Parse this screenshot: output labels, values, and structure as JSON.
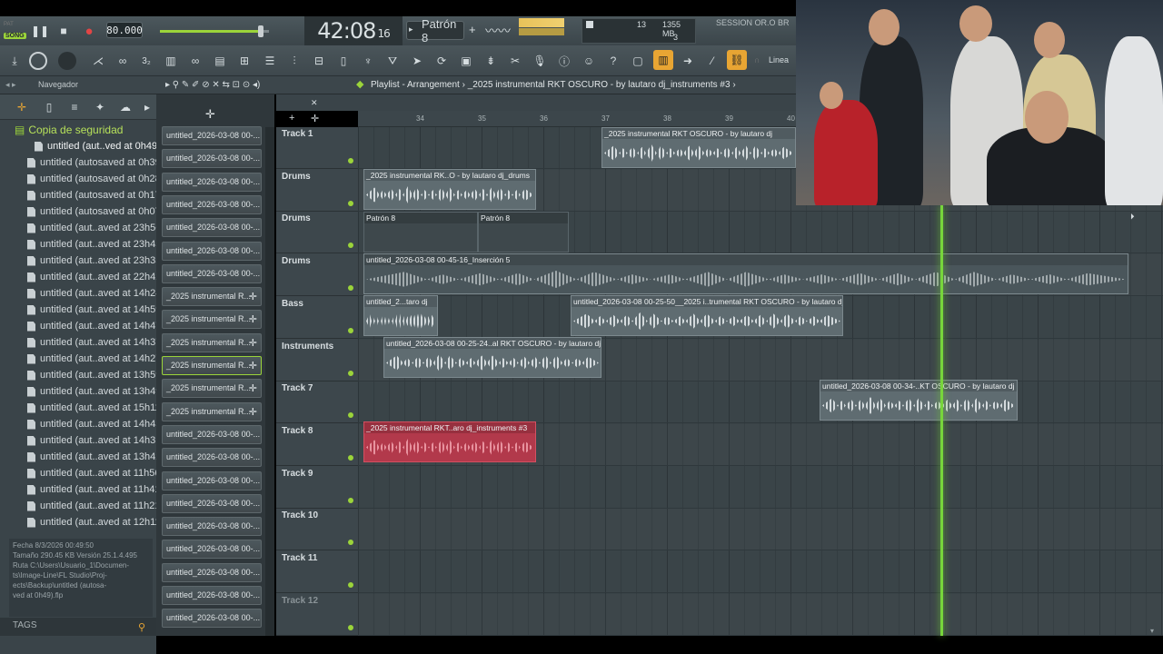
{
  "top": {
    "pat_label": "PAT",
    "song_label": "SONG",
    "bpm": "80.000",
    "time": "42:08",
    "time_sub": "16",
    "pattern": "Patrón 8",
    "cpu_value": "13",
    "ram": "1355 MB",
    "poly": "3",
    "session": "SESSION OR.O BR",
    "snap": "Linea"
  },
  "nav": {
    "navegador": "Navegador",
    "breadcrumb": "Playlist - Arrangement › _2025 instrumental RKT OSCURO - by lautaro dj_instruments #3 ›"
  },
  "browser": {
    "folder": "Copia de seguridad",
    "items": [
      "untitled (aut..ved at 0h49)",
      "untitled (autosaved at 0h39)",
      "untitled (autosaved at 0h28)",
      "untitled (autosaved at 0h17)",
      "untitled (autosaved at 0h07)",
      "untitled (aut..aved at 23h56)",
      "untitled (aut..aved at 23h45)",
      "untitled (aut..aved at 23h35)",
      "untitled (aut..aved at 22h42)",
      "untitled (aut..aved at 14h24)",
      "untitled (aut..aved at 14h59)",
      "untitled (aut..aved at 14h47)",
      "untitled (aut..aved at 14h37)",
      "untitled (aut..aved at 14h27)",
      "untitled (aut..aved at 13h59)",
      "untitled (aut..aved at 13h49)",
      "untitled (aut..aved at 15h11)",
      "untitled (aut..aved at 14h43)",
      "untitled (aut..aved at 14h31)",
      "untitled (aut..aved at 13h42)",
      "untitled (aut..aved at 11h56)",
      "untitled (aut..aved at 11h41)",
      "untitled (aut..aved at 11h21)",
      "untitled (aut..aved at 12h11)"
    ],
    "info_lines": [
      "Fecha      8/3/2026 00:49:50",
      "Tamaño   290.45 KB   Versión  25.1.4.495",
      "Ruta       C:\\Users\\Usuario_1\\Documen-",
      "ts\\Image-Line\\FL Studio\\Proj-",
      "ects\\Backup\\untitled (autosa-",
      "ved at 0h49).flp"
    ],
    "tags": "TAGS"
  },
  "channels": [
    "untitled_2026-03-08 00-...",
    "untitled_2026-03-08 00-...",
    "untitled_2026-03-08 00-...",
    "untitled_2026-03-08 00-...",
    "untitled_2026-03-08 00-...",
    "untitled_2026-03-08 00-...",
    "untitled_2026-03-08 00-...",
    "_2025 instrumental R...",
    "_2025 instrumental R...",
    "_2025 instrumental R...",
    "_2025 instrumental R...",
    "_2025 instrumental R...",
    "_2025 instrumental R...",
    "untitled_2026-03-08 00-...",
    "untitled_2026-03-08 00-...",
    "untitled_2026-03-08 00-...",
    "untitled_2026-03-08 00-...",
    "untitled_2026-03-08 00-...",
    "untitled_2026-03-08 00-...",
    "untitled_2026-03-08 00-...",
    "untitled_2026-03-08 00-...",
    "untitled_2026-03-08 00-..."
  ],
  "ruler": [
    "34",
    "35",
    "36",
    "37",
    "38",
    "39",
    "40"
  ],
  "tracks": [
    "Track 1",
    "Drums",
    "Drums",
    "Drums",
    "Bass",
    "Instruments",
    "Track 7",
    "Track 8",
    "Track 9",
    "Track 10",
    "Track 11",
    "Track 12"
  ],
  "clips": {
    "c1": "_2025 instrumental RKT OSCURO - by lautaro dj",
    "c2": "_2025 instrumental RK..O - by lautaro dj_drums",
    "c3a": "Patrón 8",
    "c3b": "Patrón 8",
    "c4": "untitled_2026-03-08 00-45-16_Inserción 5",
    "c5a": "untitled_2...taro dj",
    "c5b": "untitled_2026-03-08 00-25-50__2025 i..trumental RKT OSCURO - by lautaro dj",
    "c6": "untitled_2026-03-08 00-25-24..al RKT OSCURO - by lautaro dj",
    "c7": "untitled_2026-03-08 00-34-..KT OSCURO - by lautaro dj",
    "c8": "_2025 instrumental RKT..aro dj_instruments #3"
  }
}
